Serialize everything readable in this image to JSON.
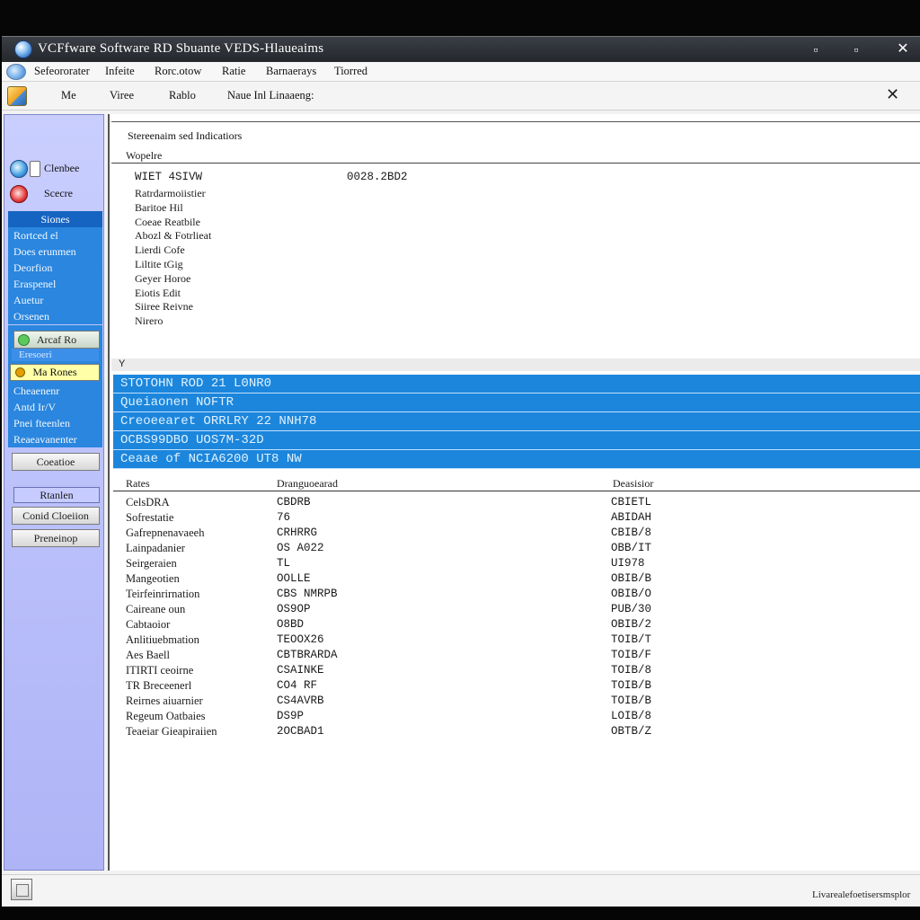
{
  "window": {
    "title": "VCFfware Software RD Sbuante VEDS-Hlaueaims",
    "min_label": "▫",
    "max_label": "▫",
    "close_label": "✕"
  },
  "menubar": {
    "items": [
      "Sefeororater",
      "Infeite",
      "Rorc.otow",
      "Ratie",
      "Barnaerays",
      "Tiorred"
    ]
  },
  "toolbar": {
    "items": [
      "Me",
      "Viree",
      "Rablo",
      "Naue Inl Linaaeng:"
    ],
    "close_label": "✕"
  },
  "sidebar": {
    "top_items": [
      "Clenbee",
      "Scecre"
    ],
    "list_header": "Siones",
    "list_items": [
      "Rortced el",
      "Does erunmen",
      "Deorfion",
      "Eraspenel",
      "Auetur",
      "Orsenen"
    ],
    "mid_button": "Arcaf Ro",
    "mid_highlight": "Eresoeri",
    "selected_button": "Ma Rones",
    "list2_items": [
      "Cheaenenr",
      "Antd Ir/V",
      "Pnei fteenlen",
      "Reaeavanenter"
    ],
    "creation_button": "Coeatioe",
    "group_header": "Rtanlen",
    "cond_button": "Conid Cloeiion",
    "proc_button": "Preneinop"
  },
  "info": {
    "title": "Stereenaim sed Indicatiors",
    "subtitle": "Wopelre",
    "key": "WIET 4SIVW",
    "value": "0028.2BD2",
    "lines": [
      "Ratrdarmoiistier",
      "Baritoe Hil",
      "Coeae Reatbile",
      "Abozl & Fotrlieat",
      "Lierdi Cofe",
      "Liltite tGig",
      "Geyer Horoe",
      "Eiotis Edit",
      "Siiree Reivne",
      "Nirero"
    ]
  },
  "collapse_label": "Y",
  "highlight_rows": [
    "STOTOHN ROD 21 L0NR0",
    "Queiaonen NOFTR",
    "Creoeearet ORRLRY 22 NNH78",
    "OCBS99DBO UOS7M-32D",
    "Ceaae of NCIA6200 UT8 NW"
  ],
  "table": {
    "headers": [
      "Rates",
      "Dranguoearad",
      "Deasisior"
    ],
    "rows": [
      [
        "CelsDRA",
        "CBDRB",
        "CBIETL"
      ],
      [
        "Sofrestatie",
        "76",
        "ABIDAH"
      ],
      [
        "Gafrepnenavaeeh",
        "CRHRRG",
        "CBIB/8"
      ],
      [
        "Lainpadanier",
        "OS A022",
        "OBB/IT"
      ],
      [
        "Seirgeraien",
        "TL",
        "UI978"
      ],
      [
        "Mangeotien",
        "OOLLE",
        "OBIB/B"
      ],
      [
        "Teirfeinrirnation",
        "CBS NMRPB",
        "OBIB/O"
      ],
      [
        "Caireane oun",
        "OS9OP",
        "PUB/30"
      ],
      [
        "Cabtaoior",
        "O8BD",
        "OBIB/2"
      ],
      [
        "Anlitiuebmation",
        "TEOOX26",
        "TOIB/T"
      ],
      [
        "Aes Baell",
        "CBTBRARDA",
        "TOIB/F"
      ],
      [
        "ITIRTI ceoirne",
        "CSAINKE",
        "TOIB/8"
      ],
      [
        "TR Breceenerl",
        "CO4 RF",
        "TOIB/B"
      ],
      [
        "Reirnes aiuarnier",
        "CS4AVRB",
        "TOIB/B"
      ],
      [
        "Regeum Oatbaies",
        "DS9P",
        "LOIB/8"
      ],
      [
        "Teaeiar Gieapiraiien",
        "2OCBAD1",
        "OBTB/Z"
      ]
    ]
  },
  "statusbar": {
    "text": "Livarealefoetisersmsplor"
  }
}
